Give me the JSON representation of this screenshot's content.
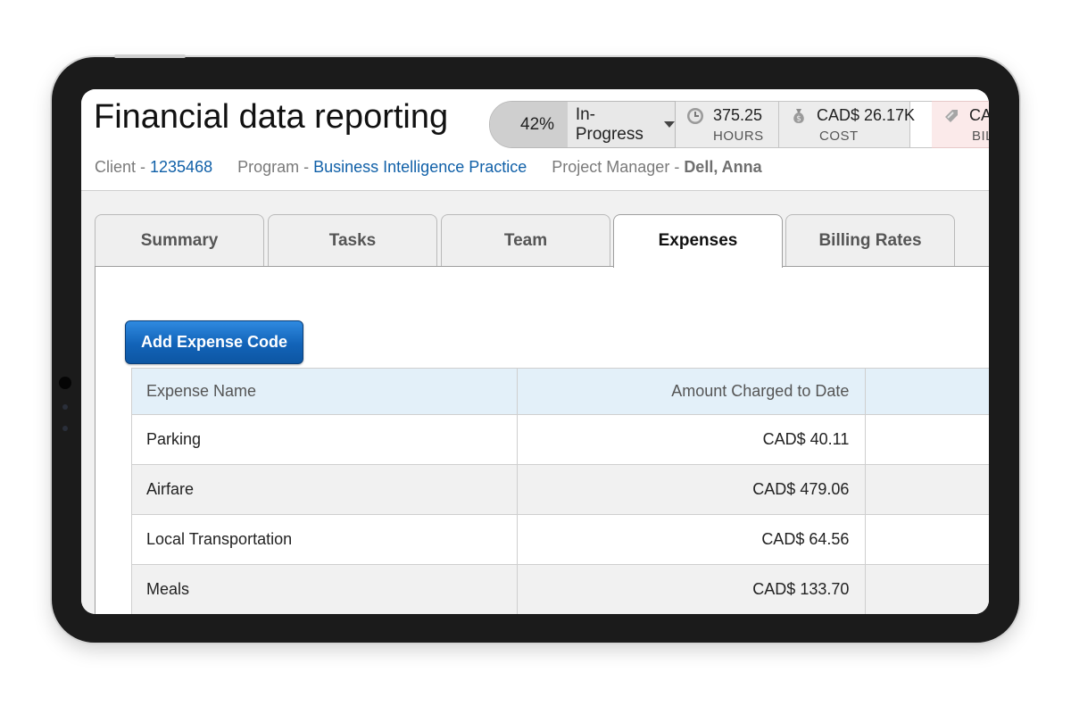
{
  "project": {
    "title": "Financial data reporting",
    "client_label": "Client - ",
    "client_value": "1235468",
    "program_label": "Program - ",
    "program_value": "Business Intelligence Practice",
    "manager_label": "Project Manager - ",
    "manager_value": "Dell, Anna"
  },
  "status": {
    "progress_percent": 42,
    "progress_text": "42%",
    "state": "In-Progress",
    "hours_value": "375.25",
    "hours_label": "HOURS",
    "cost_value": "CAD$ 26.17K",
    "cost_label": "COST",
    "billing_value": "CA",
    "billing_label": "BIL",
    "icons": [
      "clock-icon",
      "money-bag-icon",
      "tag-icon",
      "dropdown-caret-icon"
    ]
  },
  "tabs": [
    {
      "label": "Summary",
      "active": false
    },
    {
      "label": "Tasks",
      "active": false
    },
    {
      "label": "Team",
      "active": false
    },
    {
      "label": "Expenses",
      "active": true
    },
    {
      "label": "Billing Rates",
      "active": false
    }
  ],
  "expenses": {
    "add_button": "Add Expense Code",
    "columns": [
      "Expense Name",
      "Amount Charged to Date",
      ""
    ],
    "rows": [
      {
        "name": "Parking",
        "amount": "CAD$ 40.11"
      },
      {
        "name": "Airfare",
        "amount": "CAD$ 479.06"
      },
      {
        "name": "Local Transportation",
        "amount": "CAD$ 64.56"
      },
      {
        "name": "Meals",
        "amount": "CAD$ 133.70"
      }
    ]
  },
  "colors": {
    "accent_link": "#1060a8",
    "button_blue": "#1263b8",
    "header_row": "#e3f0f9",
    "billing_tint": "#fbeaea"
  }
}
